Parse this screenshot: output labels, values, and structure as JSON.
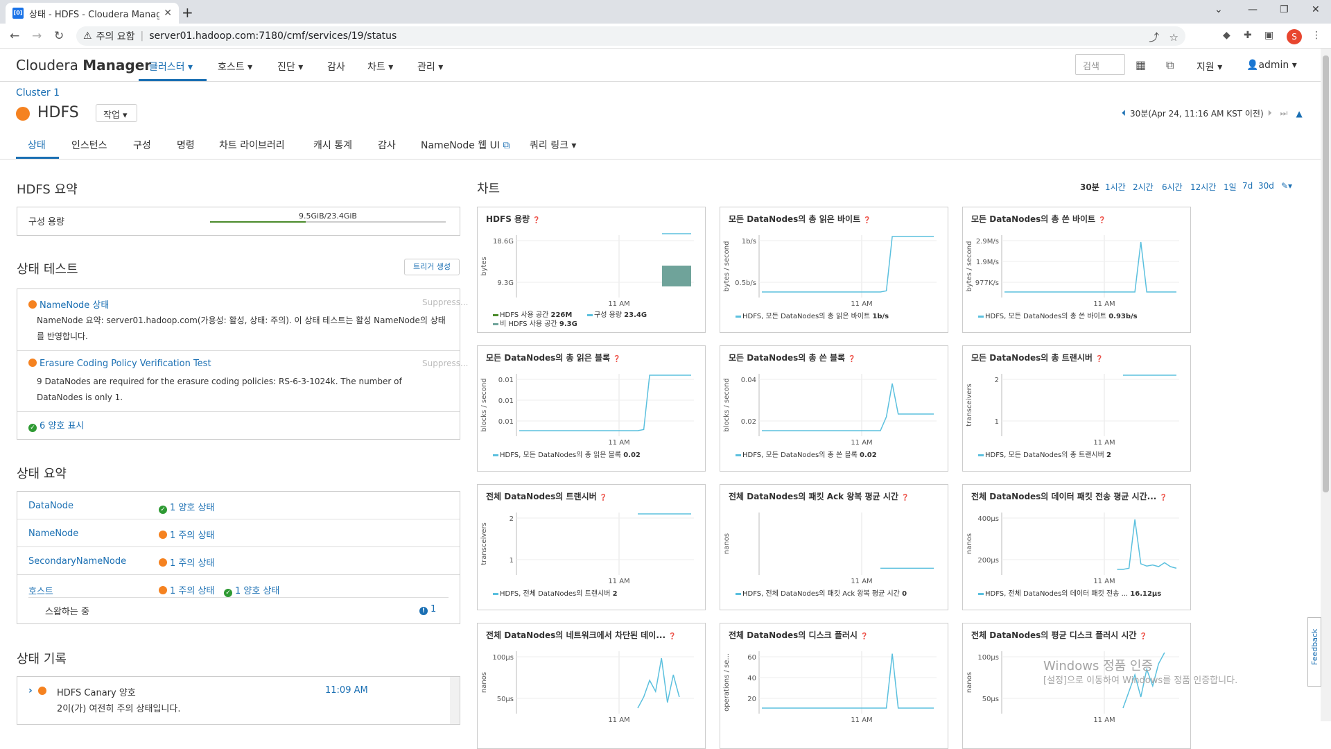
{
  "browser": {
    "tab_title": "상태 - HDFS - Cloudera Manag",
    "url_warning": "주의 요함",
    "url": "server01.hadoop.com:7180/cmf/services/19/status",
    "profile_initial": "S"
  },
  "header": {
    "logo_light": "Cloudera",
    "logo_bold": "Manager",
    "nav": [
      "클러스터 ▾",
      "호스트 ▾",
      "진단 ▾",
      "감사",
      "차트 ▾",
      "관리 ▾"
    ],
    "search_placeholder": "검색",
    "support": "지원 ▾",
    "user": "admin ▾"
  },
  "service": {
    "breadcrumb": "Cluster 1",
    "name": "HDFS",
    "actions_label": "작업 ▾",
    "time_range_label": "30분(Apr 24, 11:16 AM KST 이전)"
  },
  "subtabs": [
    "상태",
    "인스턴스",
    "구성",
    "명령",
    "차트 라이브러리",
    "캐시 통계",
    "감사",
    "NameNode 웹 UI",
    "쿼리 링크 ▾"
  ],
  "summary": {
    "title": "HDFS 요약",
    "capacity_label": "구성 용량",
    "capacity_text": "9.5GiB/23.4GiB",
    "capacity_fraction": 0.406
  },
  "health_tests": {
    "title": "상태 테스트",
    "trigger_label": "트리거 생성",
    "items": [
      {
        "name": "NameNode 상태",
        "suppress": "Suppress...",
        "desc": "NameNode 요약: server01.hadoop.com(가용성: 활성, 상태: 주의). 이 상태 테스트는 활성 NameNode의 상태를 반영합니다."
      },
      {
        "name": "Erasure Coding Policy Verification Test",
        "suppress": "Suppress...",
        "desc": "9 DataNodes are required for the erasure coding policies: RS-6-3-1024k. The number of DataNodes is only 1."
      }
    ],
    "good_link": "6 양호 표시"
  },
  "status_summary": {
    "title": "상태 요약",
    "rows": [
      {
        "label": "DataNode",
        "status": "1 양호 상태",
        "kind": "ok"
      },
      {
        "label": "NameNode",
        "status": "1 주의 상태",
        "kind": "warn"
      },
      {
        "label": "SecondaryNameNode",
        "status": "1 주의 상태",
        "kind": "warn"
      },
      {
        "label": "호스트",
        "status": "1 주의 상태",
        "status2": "1 양호 상태",
        "kind": "warn"
      }
    ],
    "swapping_label": "스왑하는 중",
    "swapping_count": "1"
  },
  "history": {
    "title": "상태 기록",
    "item_name": "HDFS Canary 양호",
    "item_time": "11:09 AM",
    "item_desc": "2이(가) 여전히 주의 상태입니다."
  },
  "charts_section": {
    "title": "차트",
    "ranges": [
      "30분",
      "1시간",
      "2시간",
      "6시간",
      "12시간",
      "1일",
      "7d",
      "30d"
    ],
    "selected_range": "30분"
  },
  "chart_data": [
    {
      "type": "area",
      "title": "HDFS 용량",
      "ylabel": "bytes",
      "yticks": [
        "18.6G",
        "9.3G"
      ],
      "xtick": "11 AM",
      "series": [
        {
          "name": "HDFS 사용 공간",
          "value": "226M"
        },
        {
          "name": "구성 용량",
          "value": "23.4G"
        },
        {
          "name": "비 HDFS 사용 공간",
          "value": "9.3G"
        }
      ],
      "color": "#6fa39a"
    },
    {
      "type": "line",
      "title": "모든 DataNodes의 총 읽은 바이트",
      "ylabel": "bytes / second",
      "yticks": [
        "1b/s",
        "0.5b/s"
      ],
      "xtick": "11 AM",
      "series": [
        {
          "name": "HDFS, 모든 DataNodes의 총 읽은 바이트",
          "value": "1b/s"
        }
      ],
      "values": [
        0,
        0,
        0,
        0,
        0,
        0,
        0,
        0,
        0,
        0,
        0,
        0,
        0,
        0,
        0,
        0,
        0,
        0,
        0,
        0,
        0,
        0.02,
        1,
        1,
        1,
        1,
        1,
        1,
        1,
        1
      ]
    },
    {
      "type": "line",
      "title": "모든 DataNodes의 총 쓴 바이트",
      "ylabel": "bytes / second",
      "yticks": [
        "2.9M/s",
        "1.9M/s",
        "977K/s"
      ],
      "xtick": "11 AM",
      "series": [
        {
          "name": "HDFS, 모든 DataNodes의 총 쓴 바이트",
          "value": "0.93b/s"
        }
      ],
      "values": [
        0,
        0,
        0,
        0,
        0,
        0,
        0,
        0,
        0,
        0,
        0,
        0,
        0,
        0,
        0,
        0,
        0,
        0,
        0,
        0,
        0,
        0,
        0,
        0.9,
        0,
        0,
        0,
        0,
        0,
        0
      ]
    },
    {
      "type": "line",
      "title": "모든 DataNodes의 총 읽은 블록",
      "ylabel": "blocks / second",
      "yticks": [
        "0.01",
        "0.01",
        "0.01"
      ],
      "xtick": "11 AM",
      "series": [
        {
          "name": "HDFS, 모든 DataNodes의 총 읽은 블록",
          "value": "0.02"
        }
      ],
      "values": [
        0,
        0,
        0,
        0,
        0,
        0,
        0,
        0,
        0,
        0,
        0,
        0,
        0,
        0,
        0,
        0,
        0,
        0,
        0,
        0,
        0,
        0.02,
        1,
        1,
        1,
        1,
        1,
        1,
        1,
        1
      ]
    },
    {
      "type": "line",
      "title": "모든 DataNodes의 총 쓴 블록",
      "ylabel": "blocks / second",
      "yticks": [
        "0.04",
        "0.02"
      ],
      "xtick": "11 AM",
      "series": [
        {
          "name": "HDFS, 모든 DataNodes의 총 쓴 블록",
          "value": "0.02"
        }
      ],
      "values": [
        0,
        0,
        0,
        0,
        0,
        0,
        0,
        0,
        0,
        0,
        0,
        0,
        0,
        0,
        0,
        0,
        0,
        0,
        0,
        0,
        0,
        0.25,
        0.85,
        0.3,
        0.3,
        0.3,
        0.3,
        0.3,
        0.3,
        0.3
      ]
    },
    {
      "type": "line",
      "title": "모든 DataNodes의 총 트랜시버",
      "ylabel": "transceivers",
      "yticks": [
        "2",
        "1"
      ],
      "xtick": "11 AM",
      "series": [
        {
          "name": "HDFS, 모든 DataNodes의 총 트랜시버",
          "value": "2"
        }
      ],
      "values": [
        null,
        null,
        null,
        null,
        null,
        null,
        null,
        null,
        null,
        null,
        null,
        null,
        null,
        null,
        null,
        null,
        null,
        null,
        null,
        null,
        1,
        1,
        1,
        1,
        1,
        1,
        1,
        1,
        1,
        1
      ]
    },
    {
      "type": "line",
      "title": "전체 DataNodes의 트랜시버",
      "ylabel": "transceivers",
      "yticks": [
        "2",
        "1"
      ],
      "xtick": "11 AM",
      "series": [
        {
          "name": "HDFS, 전체 DataNodes의 트랜시버",
          "value": "2"
        }
      ],
      "values": [
        null,
        null,
        null,
        null,
        null,
        null,
        null,
        null,
        null,
        null,
        null,
        null,
        null,
        null,
        null,
        null,
        null,
        null,
        null,
        null,
        1,
        1,
        1,
        1,
        1,
        1,
        1,
        1,
        1,
        1
      ]
    },
    {
      "type": "line",
      "title": "전체 DataNodes의 패킷 Ack 왕복 평균 시간",
      "ylabel": "nanos",
      "yticks": [],
      "xtick": "11 AM",
      "series": [
        {
          "name": "HDFS, 전체 DataNodes의 패킷 Ack 왕복 평균 시간",
          "value": "0"
        }
      ],
      "values": [
        null,
        null,
        null,
        null,
        null,
        null,
        null,
        null,
        null,
        null,
        null,
        null,
        null,
        null,
        null,
        null,
        null,
        null,
        null,
        null,
        0.02,
        0.02,
        0.02,
        0.02,
        0.02,
        0.02,
        0.02,
        0.02,
        0.02,
        0.02
      ]
    },
    {
      "type": "line",
      "title": "전체 DataNodes의 데이터 패킷 전송 평균 시간...",
      "ylabel": "nanos",
      "yticks": [
        "400μs",
        "200μs"
      ],
      "xtick": "11 AM",
      "series": [
        {
          "name": "HDFS, 전체 DataNodes의 데이터 패킷 전송 ...",
          "value": "16.12μs"
        }
      ],
      "values": [
        null,
        null,
        null,
        null,
        null,
        null,
        null,
        null,
        null,
        null,
        null,
        null,
        null,
        null,
        null,
        null,
        null,
        null,
        null,
        0,
        0,
        0.02,
        0.9,
        0.1,
        0.06,
        0.08,
        0.05,
        0.12,
        0.05,
        0.02
      ]
    },
    {
      "type": "line",
      "title": "전체 DataNodes의 네트워크에서 차단된 데이...",
      "ylabel": "nanos",
      "yticks": [
        "100μs",
        "50μs"
      ],
      "xtick": "11 AM",
      "series": [],
      "values": [
        null,
        null,
        null,
        null,
        null,
        null,
        null,
        null,
        null,
        null,
        null,
        null,
        null,
        null,
        null,
        null,
        null,
        null,
        null,
        null,
        0,
        0.2,
        0.5,
        0.3,
        0.9,
        0.1,
        0.6,
        0.2,
        null,
        null
      ]
    },
    {
      "type": "line",
      "title": "전체 DataNodes의 디스크 플러시",
      "ylabel": "operations / se...",
      "yticks": [
        "60",
        "40",
        "20"
      ],
      "xtick": "11 AM",
      "series": [],
      "values": [
        0,
        0,
        0,
        0,
        0,
        0,
        0,
        0,
        0,
        0,
        0,
        0,
        0,
        0,
        0,
        0,
        0,
        0,
        0,
        0,
        0,
        0,
        0.98,
        0,
        0,
        0,
        0,
        0,
        0,
        0
      ]
    },
    {
      "type": "line",
      "title": "전체 DataNodes의 평균 디스크 플러시 시간",
      "ylabel": "nanos",
      "yticks": [
        "100μs",
        "50μs"
      ],
      "xtick": "11 AM",
      "series": [],
      "values": [
        null,
        null,
        null,
        null,
        null,
        null,
        null,
        null,
        null,
        null,
        null,
        null,
        null,
        null,
        null,
        null,
        null,
        null,
        null,
        null,
        0,
        0.3,
        0.6,
        0.2,
        0.7,
        0.4,
        0.8,
        1,
        null,
        null
      ]
    }
  ],
  "watermark": {
    "line1": "Windows 정품 인증",
    "line2": "[설정]으로 이동하여 Windows를 정품 인증합니다."
  },
  "feedback_label": "Feedback",
  "colors": {
    "accent": "#1a6fb3",
    "warning": "#f58220",
    "good": "#2e9a33",
    "chart_line": "#5bc0de"
  }
}
